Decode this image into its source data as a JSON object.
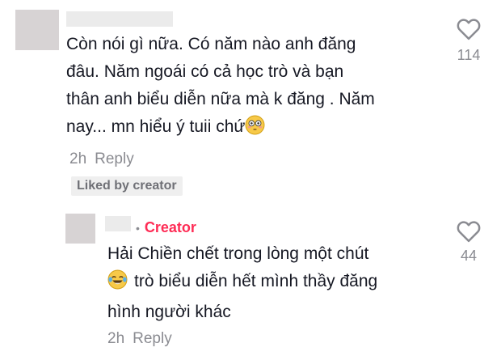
{
  "comment": {
    "likes": "114",
    "lines": [
      "Còn nói gì nữa. Có năm nào anh đăng",
      "đâu. Năm ngoái có cả học trò và bạn",
      "thân anh biểu diễn nữa mà k đăng . Năm",
      "nay... mn hiểu ý tuii chứ"
    ],
    "emoji": "flushed-face-emoji",
    "time": "2h",
    "reply_label": "Reply",
    "liked_badge": "Liked by creator"
  },
  "reply": {
    "creator_label": "Creator",
    "likes": "44",
    "lines": [
      "Hải Chiền chết trong lòng một chút",
      "trò biểu diễn hết mình thầy đăng",
      "hình người khác"
    ],
    "emoji": "tears-of-joy-emoji",
    "time": "2h",
    "reply_label": "Reply"
  },
  "colors": {
    "creator": "#fe2c55",
    "muted": "#8a8b91",
    "text": "#161823"
  },
  "icons": [
    "heart-outline-icon"
  ]
}
